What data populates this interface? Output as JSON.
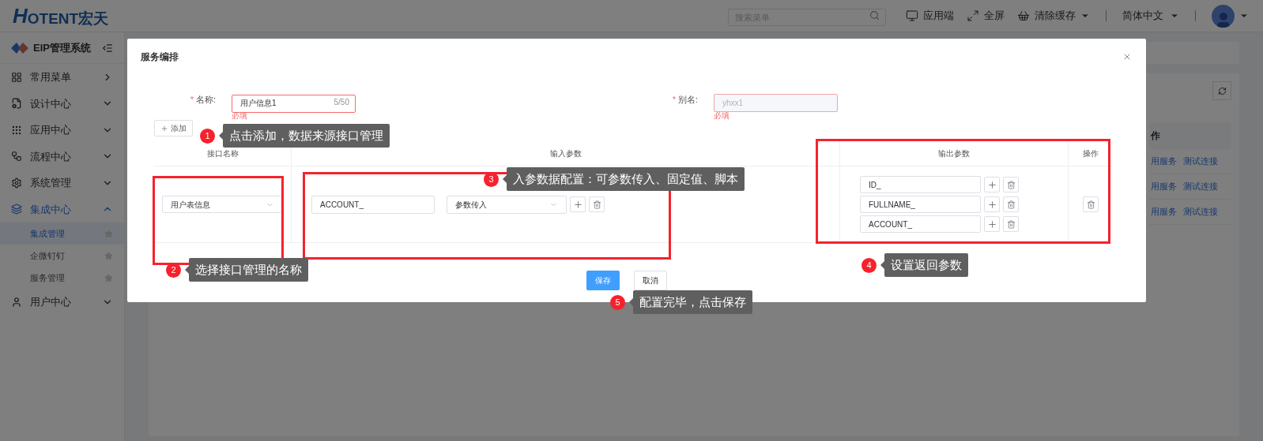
{
  "header": {
    "logo_initial": "H",
    "logo_text": "OTENT宏天",
    "search": {
      "placeholder": "搜索菜单"
    },
    "actions": [
      "应用端",
      "全屏",
      "清除缓存"
    ],
    "language": "简体中文"
  },
  "sidebar": {
    "title": "EIP管理系统",
    "items": [
      {
        "kind": "shortcut",
        "label": "常用菜单",
        "expanded": false
      },
      {
        "kind": "group",
        "label": "设计中心",
        "expanded": false
      },
      {
        "kind": "group",
        "label": "应用中心",
        "expanded": false
      },
      {
        "kind": "group",
        "label": "流程中心",
        "expanded": false
      },
      {
        "kind": "group",
        "label": "系统管理",
        "expanded": false
      },
      {
        "kind": "group",
        "label": "集成中心",
        "expanded": true,
        "children": [
          {
            "label": "集成管理",
            "selected": true
          },
          {
            "label": "企微钉钉",
            "selected": false
          },
          {
            "label": "服务管理",
            "selected": false
          }
        ]
      },
      {
        "kind": "group",
        "label": "用户中心",
        "expanded": false
      }
    ]
  },
  "background_table": {
    "column_1": "作",
    "rows": [
      [
        "用服务",
        "测试连接"
      ],
      [
        "用服务",
        "测试连接"
      ],
      [
        "用服务",
        "测试连接"
      ]
    ]
  },
  "dialog": {
    "title": "服务编排",
    "fields": [
      {
        "label": "名称:",
        "required_mark": "*",
        "value": "用户信息1",
        "counter": "5/50",
        "error": "必填",
        "disabled": false
      },
      {
        "label": "别名:",
        "required_mark": "*",
        "value": "yhxx1",
        "error": "必填",
        "disabled": true
      }
    ],
    "add_button": "添加",
    "table": {
      "columns": [
        "接口名称",
        "输入参数",
        "输出参数",
        "操作"
      ],
      "rows": [
        {
          "interface": "用户表信息",
          "inputs": [
            {
              "name": "ACCOUNT_",
              "source": "参数传入"
            }
          ],
          "outputs": [
            "ID_",
            "FULLNAME_",
            "ACCOUNT_"
          ]
        }
      ]
    },
    "buttons": {
      "save": "保存",
      "cancel": "取消"
    }
  },
  "annotations": [
    {
      "number": "1",
      "text": "点击添加，数据来源接口管理"
    },
    {
      "number": "2",
      "text": "选择接口管理的名称"
    },
    {
      "number": "3",
      "text": "入参数据配置：可参数传入、固定值、脚本"
    },
    {
      "number": "4",
      "text": "设置返回参数"
    },
    {
      "number": "5",
      "text": "配置完毕，点击保存"
    }
  ]
}
